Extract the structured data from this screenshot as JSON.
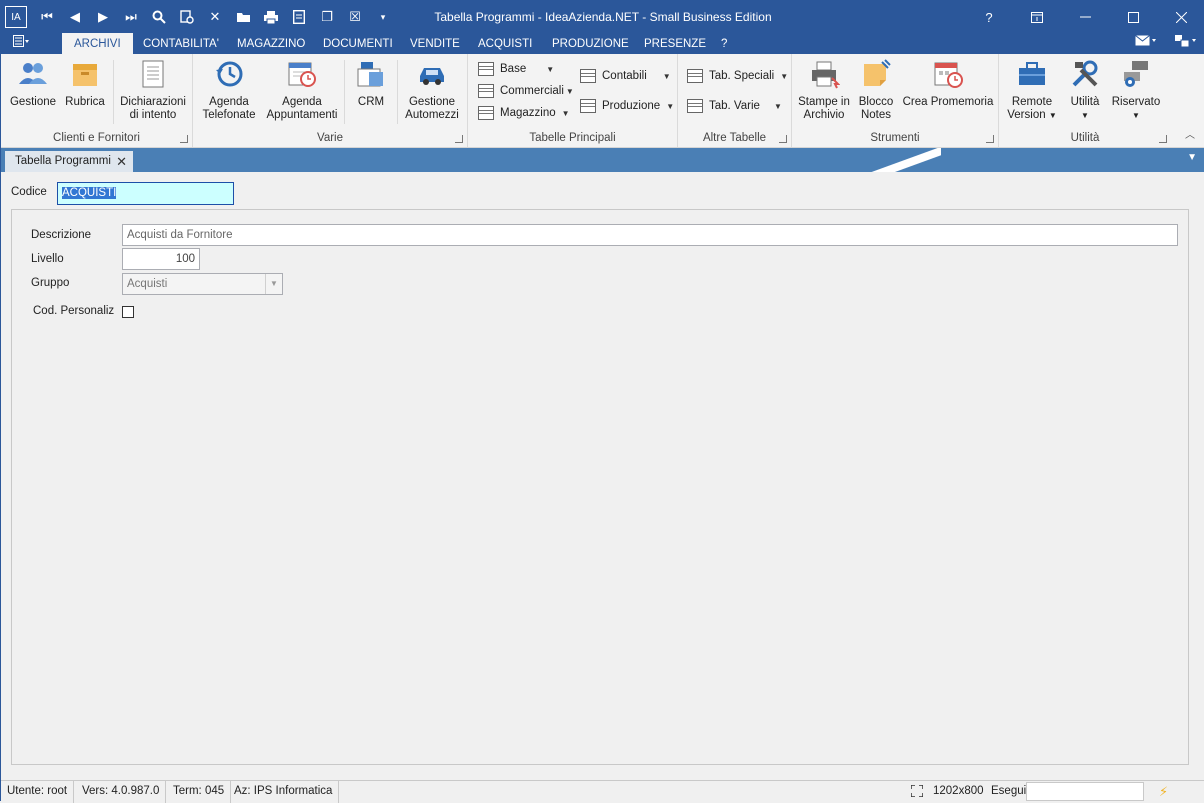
{
  "window": {
    "title": "Tabella Programmi - IdeaAzienda.NET - Small Business Edition",
    "help": "?",
    "app_icon": "IA"
  },
  "qat": [
    {
      "name": "first-record-icon",
      "glyph": "⏮"
    },
    {
      "name": "prev-record-icon",
      "glyph": "◀"
    },
    {
      "name": "next-record-icon",
      "glyph": "▶"
    },
    {
      "name": "last-record-icon",
      "glyph": "⏭"
    },
    {
      "name": "search-icon",
      "glyph": "🔍"
    },
    {
      "name": "new-record-icon",
      "glyph": "⊕"
    },
    {
      "name": "delete-icon",
      "glyph": "✕"
    },
    {
      "name": "open-folder-icon",
      "glyph": "▬"
    },
    {
      "name": "print-icon",
      "glyph": "▣"
    },
    {
      "name": "report-icon",
      "glyph": "▤"
    },
    {
      "name": "copy-icon",
      "glyph": "❐"
    },
    {
      "name": "excel-icon",
      "glyph": "☒"
    },
    {
      "name": "customize-qat-icon",
      "glyph": "▾"
    }
  ],
  "tabs": [
    "ARCHIVI",
    "CONTABILITA'",
    "MAGAZZINO",
    "DOCUMENTI",
    "VENDITE",
    "ACQUISTI",
    "PRODUZIONE",
    "PRESENZE",
    "?"
  ],
  "ribbon": {
    "groups": {
      "clienti": "Clienti e Fornitori",
      "varie": "Varie",
      "tabelle": "Tabelle Principali",
      "altre": "Altre Tabelle",
      "strumenti": "Strumenti",
      "utilita": "Utilità"
    },
    "buttons": {
      "gestione": "Gestione",
      "rubrica": "Rubrica",
      "dichiarazioni_1": "Dichiarazioni",
      "dichiarazioni_2": "di intento",
      "agenda_tel_1": "Agenda",
      "agenda_tel_2": "Telefonate",
      "agenda_app_1": "Agenda",
      "agenda_app_2": "Appuntamenti",
      "crm": "CRM",
      "automezzi_1": "Gestione",
      "automezzi_2": "Automezzi",
      "base": "Base",
      "commerciali": "Commerciali",
      "magazzino": "Magazzino",
      "contabili": "Contabili",
      "produzione": "Produzione",
      "tab_speciali": "Tab. Speciali",
      "tab_varie": "Tab. Varie",
      "stampe_1": "Stampe in",
      "stampe_2": "Archivio",
      "blocco_1": "Blocco",
      "blocco_2": "Notes",
      "promemoria": "Crea Promemoria",
      "remote_1": "Remote",
      "remote_2": "Version",
      "utilita": "Utilità",
      "riservato": "Riservato"
    }
  },
  "doc_tab": {
    "label": "Tabella Programmi"
  },
  "form": {
    "codice_label": "Codice",
    "codice_value": "ACQUISTI",
    "descrizione_label": "Descrizione",
    "descrizione_value": "Acquisti da Fornitore",
    "livello_label": "Livello",
    "livello_value": "100",
    "gruppo_label": "Gruppo",
    "gruppo_value": "Acquisti",
    "codpers_label": "Cod. Personaliz",
    "codpers_checked": false
  },
  "status": {
    "utente": "Utente: root",
    "versione": "Vers: 4.0.987.0",
    "term": "Term: 045",
    "azienda": "Az: IPS Informatica",
    "resolution": "1202x800",
    "esegui": "Esegui"
  },
  "colors": {
    "title_bar": "#2b579a",
    "doc_strip": "#4a7fb5",
    "code_field": "#ccffff"
  }
}
